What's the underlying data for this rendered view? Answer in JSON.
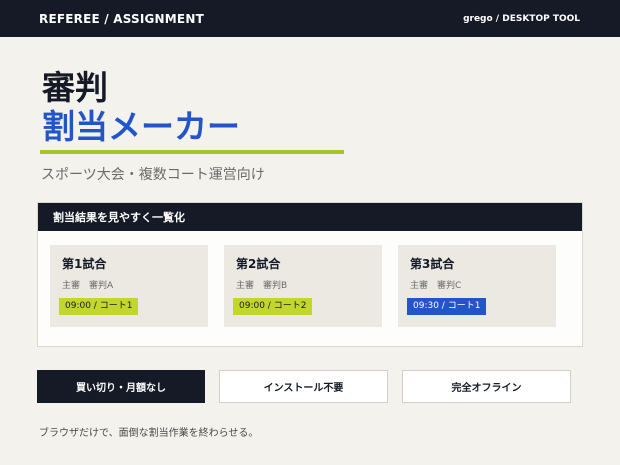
{
  "header": {
    "brand": "REFEREE / ASSIGNMENT",
    "right": "grego / DESKTOP TOOL"
  },
  "hero": {
    "title_line1": "審判",
    "title_line2": "割当メーカー",
    "subtitle": "スポーツ大会・複数コート運営向け"
  },
  "panel": {
    "title": "割当結果を見やすく一覧化",
    "cards": [
      {
        "title": "第1試合",
        "referee": "主審　審判A",
        "tag": "09:00 / コート1",
        "tag_color": "#c2d62b",
        "tag_text_color": "#151a26"
      },
      {
        "title": "第2試合",
        "referee": "主審　審判B",
        "tag": "09:00 / コート2",
        "tag_color": "#c2d62b",
        "tag_text_color": "#151a26"
      },
      {
        "title": "第3試合",
        "referee": "主審　審判C",
        "tag": "09:30 / コート1",
        "tag_color": "#2155c8",
        "tag_text_color": "#ffffff"
      }
    ]
  },
  "features": [
    {
      "label": "買い切り・月額なし"
    },
    {
      "label": "インストール不要"
    },
    {
      "label": "完全オフライン"
    }
  ],
  "footer": "ブラウザだけで、面倒な割当作業を終わらせる。",
  "colors": {
    "dark": "#151a26",
    "accent_blue": "#2155c8",
    "accent_green": "#a6c42a",
    "background": "#f4f2ec"
  }
}
